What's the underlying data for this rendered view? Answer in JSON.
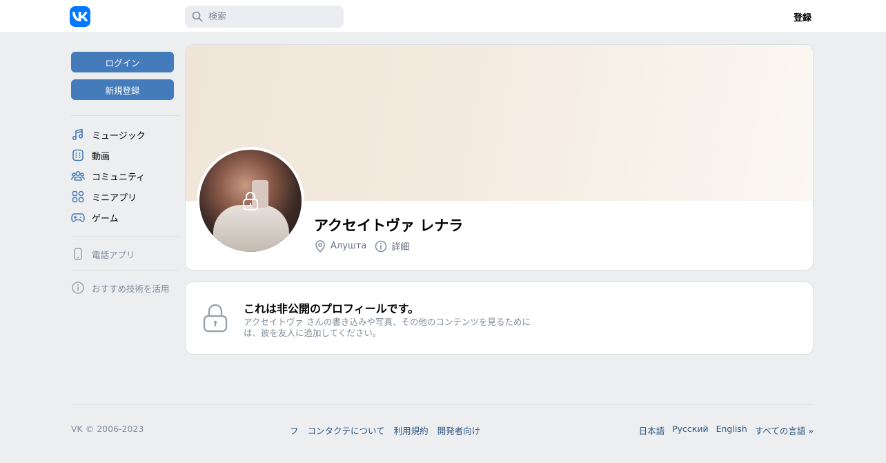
{
  "header": {
    "logo_text": "VK",
    "search_placeholder": "検索",
    "register_label": "登録"
  },
  "sidebar": {
    "login_label": "ログイン",
    "signup_label": "新規登録",
    "nav": [
      {
        "label": "ミュージック",
        "icon": "music-icon"
      },
      {
        "label": "動画",
        "icon": "video-icon"
      },
      {
        "label": "コミュニティ",
        "icon": "community-icon"
      },
      {
        "label": "ミニアプリ",
        "icon": "miniapps-icon"
      },
      {
        "label": "ゲーム",
        "icon": "gamepad-icon"
      }
    ],
    "phone_app_label": "電話アプリ",
    "recommend_label": "おすすめ技術を活用"
  },
  "profile": {
    "name": "アクセイトヴァ レナラ",
    "location": "Алушта",
    "details_label": "詳細"
  },
  "private_notice": {
    "title": "これは非公開のプロフィールです。",
    "description": "アクセイトヴァ さんの書き込みや写真、その他のコンテンツを見るためには、彼を友人に追加してください。"
  },
  "footer": {
    "copyright": "VK © 2006-2023",
    "links": [
      "フ",
      "コンタクテについて",
      "利用規約",
      "開発者向け"
    ],
    "languages": [
      "日本語",
      "Русский",
      "English",
      "すべての言語 »"
    ]
  },
  "colors": {
    "accent": "#447bba",
    "brand": "#0077ff",
    "link": "#2a5885",
    "muted": "#818c99",
    "background": "#edeef0"
  }
}
